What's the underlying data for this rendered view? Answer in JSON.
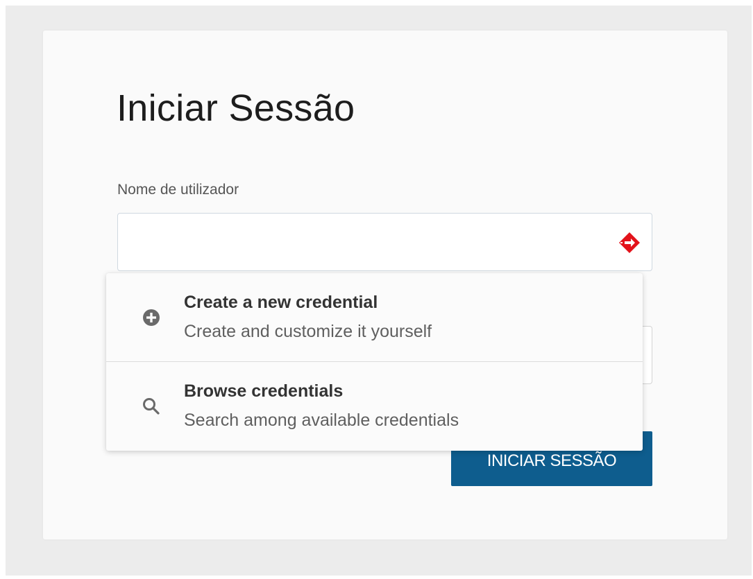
{
  "login": {
    "title": "Iniciar Sessão",
    "username_label": "Nome de utilizador",
    "username_value": "",
    "password_value": "",
    "submit_label": "INICIAR SESSÃO"
  },
  "password_manager": {
    "icon": "password-manager-icon",
    "icon_color": "#e3131b"
  },
  "dropdown": {
    "items": [
      {
        "icon": "plus-circle-icon",
        "title": "Create a new credential",
        "subtitle": "Create and customize it yourself"
      },
      {
        "icon": "search-icon",
        "title": "Browse credentials",
        "subtitle": "Search among available credentials"
      }
    ]
  },
  "colors": {
    "primary_button": "#0e5d8e",
    "background": "#ececec",
    "card": "#fafafa"
  }
}
